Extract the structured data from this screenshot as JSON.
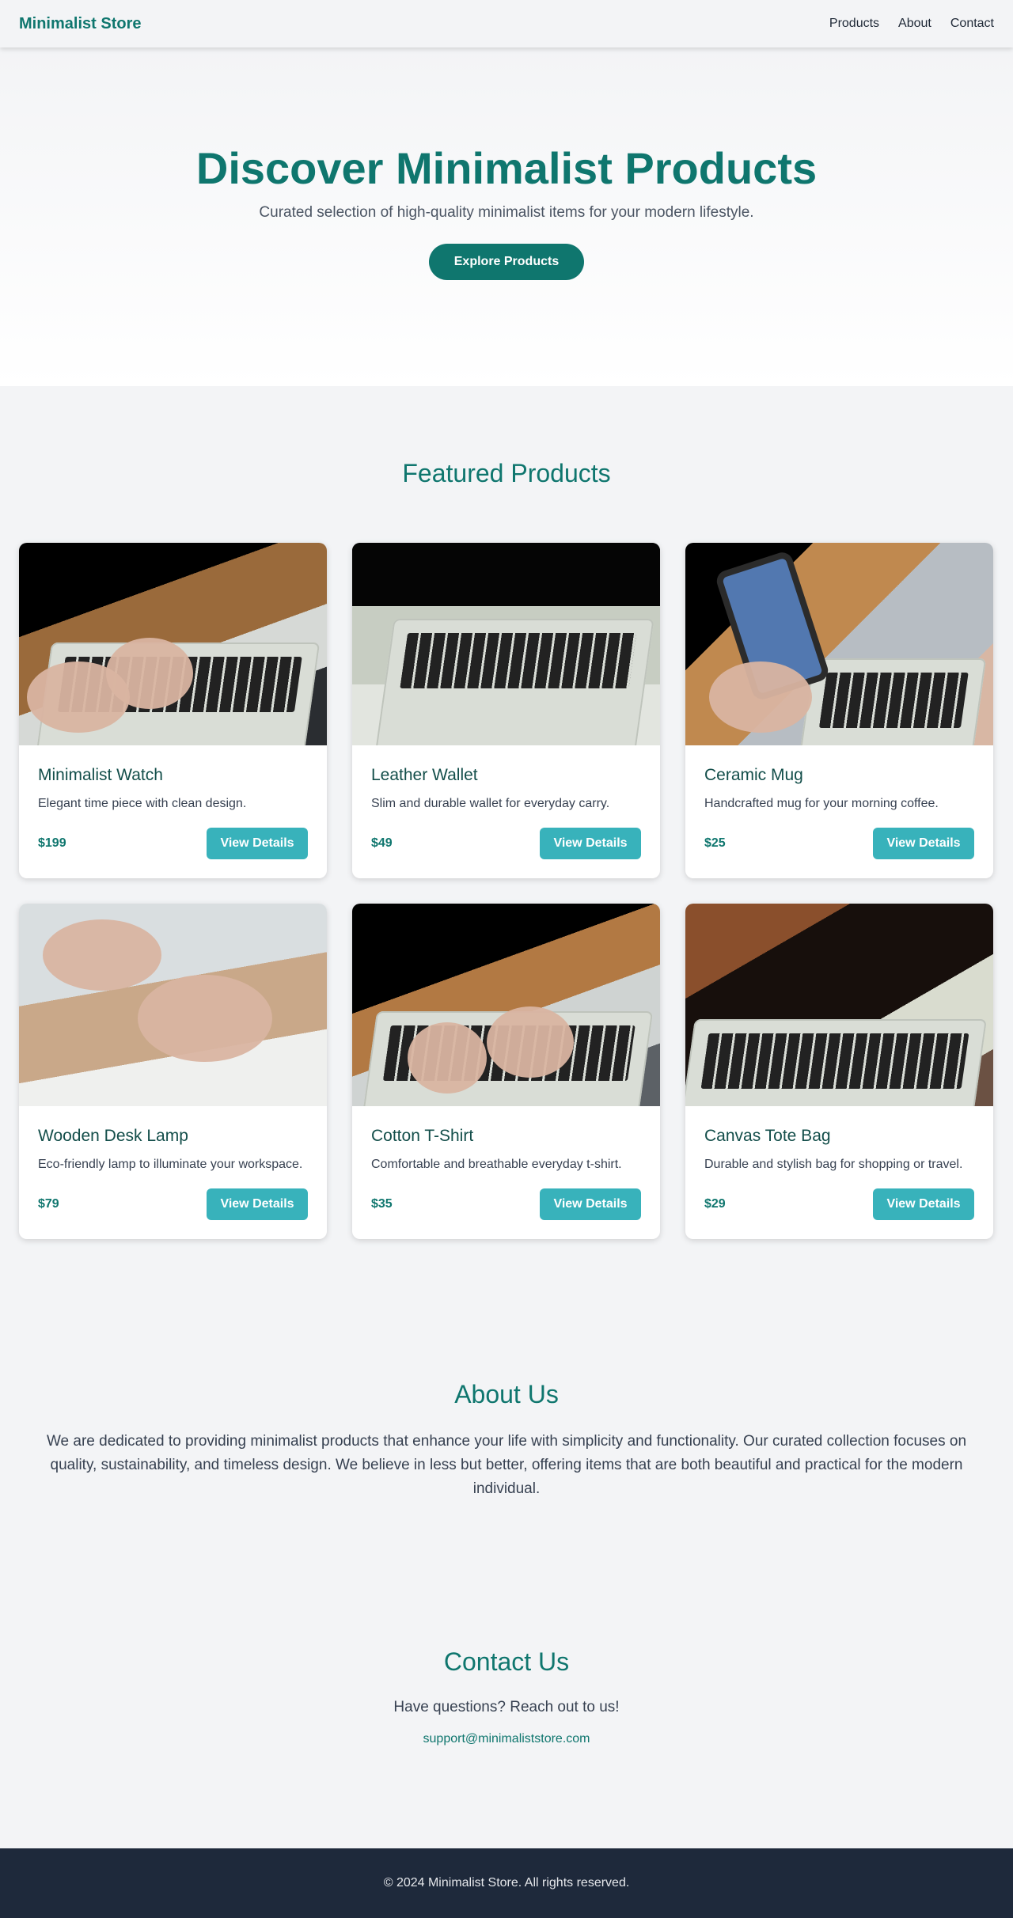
{
  "header": {
    "brand": "Minimalist Store",
    "nav": [
      "Products",
      "About",
      "Contact"
    ]
  },
  "hero": {
    "title": "Discover Minimalist Products",
    "subtitle": "Curated selection of high-quality minimalist items for your modern lifestyle.",
    "cta": "Explore Products"
  },
  "featured": {
    "title": "Featured Products",
    "button_label": "View Details",
    "products": [
      {
        "name": "Minimalist Watch",
        "description": "Elegant time piece with clean design.",
        "price": "$199"
      },
      {
        "name": "Leather Wallet",
        "description": "Slim and durable wallet for everyday carry.",
        "price": "$49"
      },
      {
        "name": "Ceramic Mug",
        "description": "Handcrafted mug for your morning coffee.",
        "price": "$25"
      },
      {
        "name": "Wooden Desk Lamp",
        "description": "Eco-friendly lamp to illuminate your workspace.",
        "price": "$79"
      },
      {
        "name": "Cotton T-Shirt",
        "description": "Comfortable and breathable everyday t-shirt.",
        "price": "$35"
      },
      {
        "name": "Canvas Tote Bag",
        "description": "Durable and stylish bag for shopping or travel.",
        "price": "$29"
      }
    ]
  },
  "about": {
    "title": "About Us",
    "text": "We are dedicated to providing minimalist products that enhance your life with simplicity and functionality. Our curated collection focuses on quality, sustainability, and timeless design. We believe in less but better, offering items that are both beautiful and practical for the modern individual."
  },
  "contact": {
    "title": "Contact Us",
    "lead": "Have questions? Reach out to us!",
    "email": "support@minimaliststore.com"
  },
  "footer": {
    "text": "© 2024 Minimalist Store. All rights reserved."
  },
  "colors": {
    "primary": "#0f766e",
    "accent": "#38b2bb",
    "footer_bg": "#1e293b"
  }
}
